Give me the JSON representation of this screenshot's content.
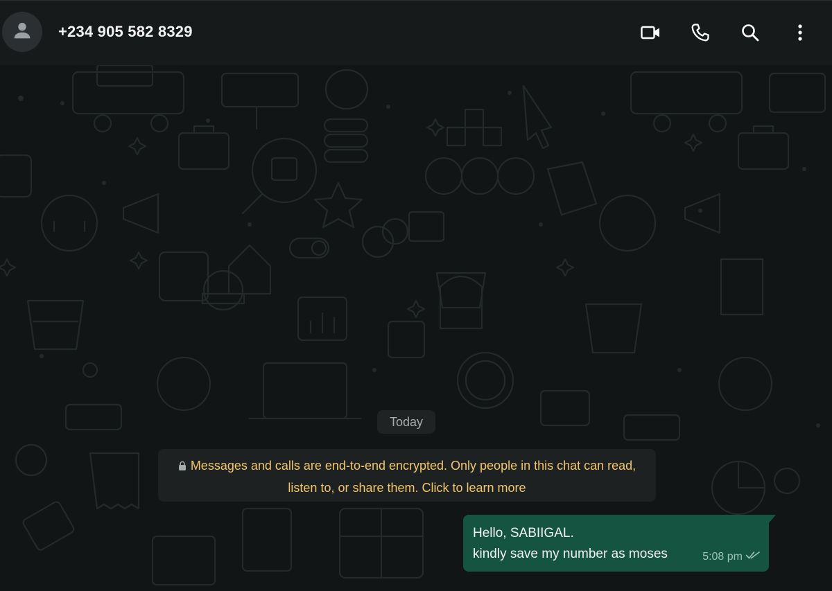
{
  "header": {
    "contact_name": "+234 905 582 8329",
    "icons": [
      "avatar-person-icon",
      "video-call-icon",
      "voice-call-icon",
      "search-icon",
      "menu-dots-icon"
    ]
  },
  "chat": {
    "date_label": "Today",
    "encryption_notice": {
      "line1": "Messages and calls are end-to-end encrypted. Only people in this chat can read,",
      "line2": "listen to, or share them. Click to learn more",
      "color": "#f2c66d"
    },
    "messages": [
      {
        "direction": "outgoing",
        "lines": [
          "Hello, SABIIGAL.",
          "kindly save my number as moses"
        ],
        "time": "5:08 pm",
        "status": "delivered"
      }
    ]
  },
  "colors": {
    "header_bg": "#171a1a",
    "chat_bg": "#121515",
    "outgoing_bubble": "#155441",
    "notice_text": "#f2c66d"
  }
}
